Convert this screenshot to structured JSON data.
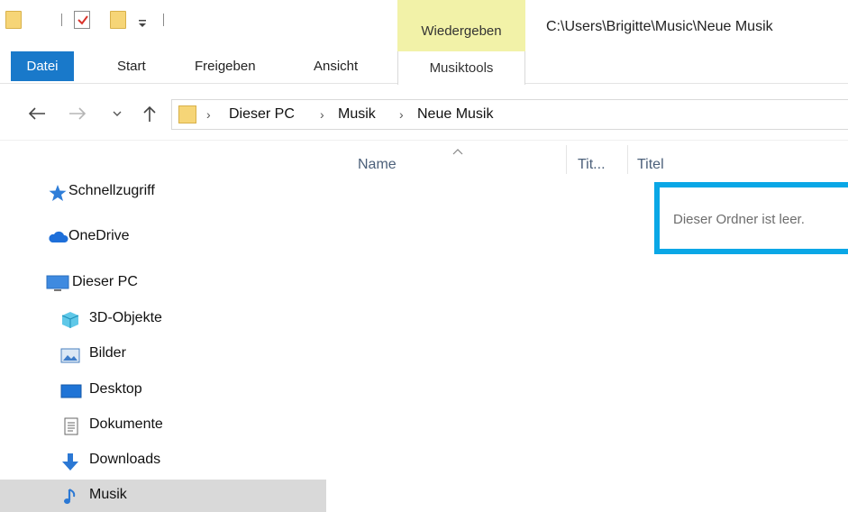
{
  "title_bar": {
    "context_tab_label": "Wiedergeben",
    "window_title": "C:\\Users\\Brigitte\\Music\\Neue Musik"
  },
  "ribbon": {
    "file_tab": "Datei",
    "tabs": [
      "Start",
      "Freigeben",
      "Ansicht"
    ],
    "context_tab": "Musiktools"
  },
  "address": {
    "crumbs": [
      "Dieser PC",
      "Musik",
      "Neue Musik"
    ]
  },
  "nav_pane": {
    "quick_access": "Schnellzugriff",
    "onedrive": "OneDrive",
    "this_pc": "Dieser PC",
    "items": [
      "3D-Objekte",
      "Bilder",
      "Desktop",
      "Dokumente",
      "Downloads",
      "Musik"
    ],
    "selected": "Musik"
  },
  "content": {
    "columns": [
      "Name",
      "Tit...",
      "Titel"
    ],
    "empty_message": "Dieser Ordner ist leer."
  },
  "colors": {
    "file_tab": "#1979ca",
    "context_tab": "#f2f2a8",
    "highlight_box": "#0aa7e6",
    "selected_row": "#d9d9d9",
    "folder": "#f6d577"
  },
  "icons": {
    "quick_access": "star-icon",
    "onedrive": "cloud-icon",
    "this_pc": "monitor-icon",
    "3d": "cube-icon",
    "bilder": "pictures-icon",
    "desktop": "desktop-icon",
    "dokumente": "document-icon",
    "downloads": "download-arrow-icon",
    "musik": "music-note-icon"
  }
}
